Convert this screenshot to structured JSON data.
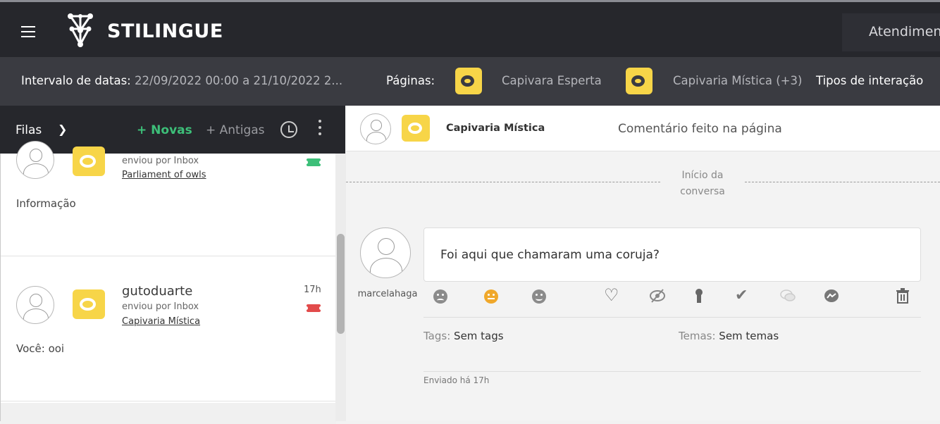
{
  "app": {
    "brand": "STILINGUE",
    "module": "Atendimento"
  },
  "filters": {
    "dates_label": "Intervalo de datas",
    "dates_value": "22/09/2022 00:00 a 21/10/2022 2...",
    "pages_label": "Páginas:",
    "page1": "Capivara Esperta",
    "page2": "Capivaria Mística (+3)",
    "types_label": "Tipos de interação"
  },
  "queue": {
    "title": "Filas",
    "novas": "+ Novas",
    "antigas": "+ Antigas"
  },
  "items": [
    {
      "via": "enviou por Inbox",
      "page": "Parliament of owls",
      "snippet": "Informação",
      "ticket_color": "#3dbf79"
    },
    {
      "user": "gutoduarte",
      "via": "enviou por Inbox",
      "page": "Capivaria Mística",
      "time": "17h",
      "snippet": "Você: ooi",
      "ticket_color": "#e24b4b"
    }
  ],
  "conversation": {
    "page_name": "Capivaria Mística",
    "type": "Comentário feito na página",
    "start_label": "Início da conversa",
    "message": "Foi aqui que chamaram uma coruja?",
    "author": "marcelahaga",
    "tags_label": "Tags:",
    "tags_value": "Sem tags",
    "themes_label": "Temas:",
    "themes_value": "Sem temas",
    "sent": "Enviado há 17h"
  },
  "colors": {
    "instagram": "#f7d548",
    "accent": "#3dbf79",
    "dark": "#26272c"
  }
}
